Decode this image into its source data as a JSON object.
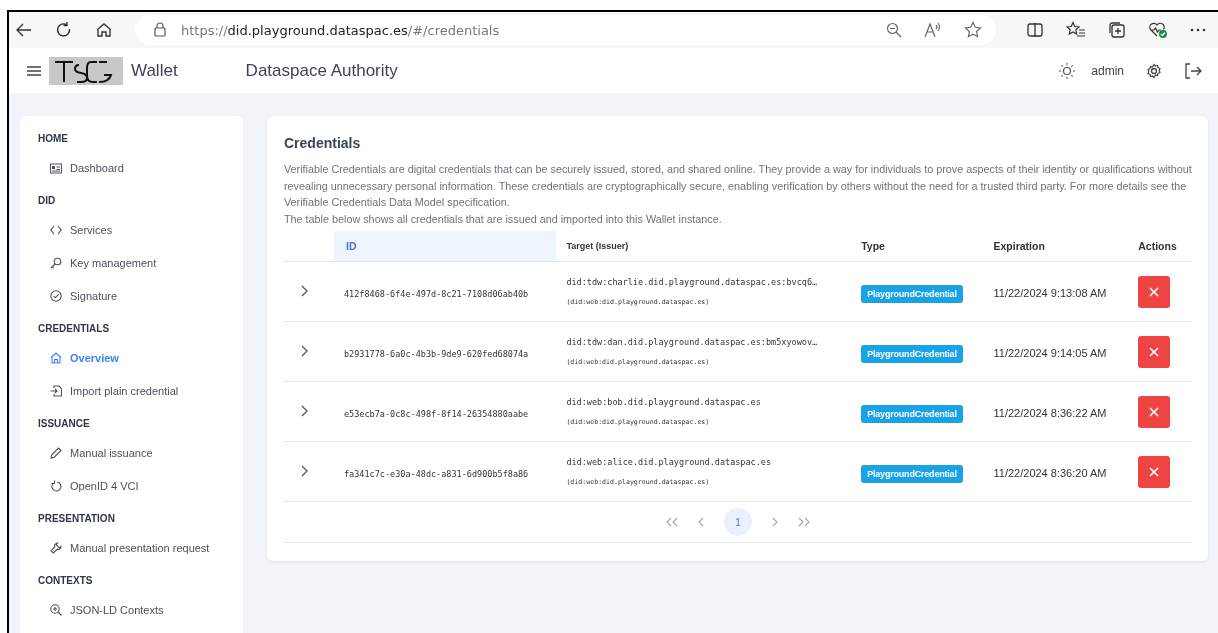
{
  "browser": {
    "url_scheme": "https://",
    "url_host": "did.playground.dataspac.es",
    "url_path": "/#/credentials"
  },
  "header": {
    "app_name": "Wallet",
    "title": "Dataspace Authority",
    "user": "admin"
  },
  "sidebar": [
    {
      "heading": "HOME",
      "items": [
        {
          "label": "Dashboard",
          "selected": false
        }
      ]
    },
    {
      "heading": "DID",
      "items": [
        {
          "label": "Services",
          "selected": false
        },
        {
          "label": "Key management",
          "selected": false
        },
        {
          "label": "Signature",
          "selected": false
        }
      ]
    },
    {
      "heading": "CREDENTIALS",
      "items": [
        {
          "label": "Overview",
          "selected": true
        },
        {
          "label": "Import plain credential",
          "selected": false
        }
      ]
    },
    {
      "heading": "ISSUANCE",
      "items": [
        {
          "label": "Manual issuance",
          "selected": false
        },
        {
          "label": "OpenID 4 VCI",
          "selected": false
        }
      ]
    },
    {
      "heading": "PRESENTATION",
      "items": [
        {
          "label": "Manual presentation request",
          "selected": false
        }
      ]
    },
    {
      "heading": "CONTEXTS",
      "items": [
        {
          "label": "JSON-LD Contexts",
          "selected": false
        }
      ]
    }
  ],
  "credentials": {
    "title": "Credentials",
    "description": [
      "Verifiable Credentials are digital credentials that can be securely issued, stored, and shared online. They provide a way for individuals to prove aspects of their identity or qualifications without revealing unnecessary personal information. These credentials are cryptographically secure, enabling verification by others without the need for a trusted third party. For more details see the Verifiable Credentials Data Model specification.",
      "The table below shows all credentials that are issued and imported into this Wallet instance."
    ],
    "columns": [
      {
        "label": "ID",
        "sorted": true
      },
      {
        "label": "Target (Issuer)",
        "sorted": false
      },
      {
        "label": "Type",
        "sorted": false
      },
      {
        "label": "Expiration",
        "sorted": false
      },
      {
        "label": "Actions",
        "sorted": false
      }
    ],
    "rows": [
      {
        "id": "412f8468-6f4e-497d-8c21-7108d06ab40b",
        "target": "did:tdw:charlie.did.playground.dataspac.es:bvcq6…",
        "issuer": "(did:web:did.playground.dataspac.es)",
        "type": "PlaygroundCredential",
        "expiration": "11/22/2024 9:13:08 AM"
      },
      {
        "id": "b2931778-6a0c-4b3b-9de9-620fed68074a",
        "target": "did:tdw:dan.did.playground.dataspac.es:bm5xyowov…",
        "issuer": "(did:web:did.playground.dataspac.es)",
        "type": "PlaygroundCredential",
        "expiration": "11/22/2024 9:14:05 AM"
      },
      {
        "id": "e53ecb7a-0c8c-498f-8f14-26354880aabe",
        "target": "did:web:bob.did.playground.dataspac.es",
        "issuer": "(did:web:did.playground.dataspac.es)",
        "type": "PlaygroundCredential",
        "expiration": "11/22/2024 8:36:22 AM"
      },
      {
        "id": "fa341c7c-e30a-48dc-a831-6d900b5f8a86",
        "target": "did:web:alice.did.playground.dataspac.es",
        "issuer": "(did:web:did.playground.dataspac.es)",
        "type": "PlaygroundCredential",
        "expiration": "11/22/2024 8:36:20 AM"
      }
    ],
    "pages": [
      {
        "label": "1",
        "selected": true
      }
    ]
  }
}
